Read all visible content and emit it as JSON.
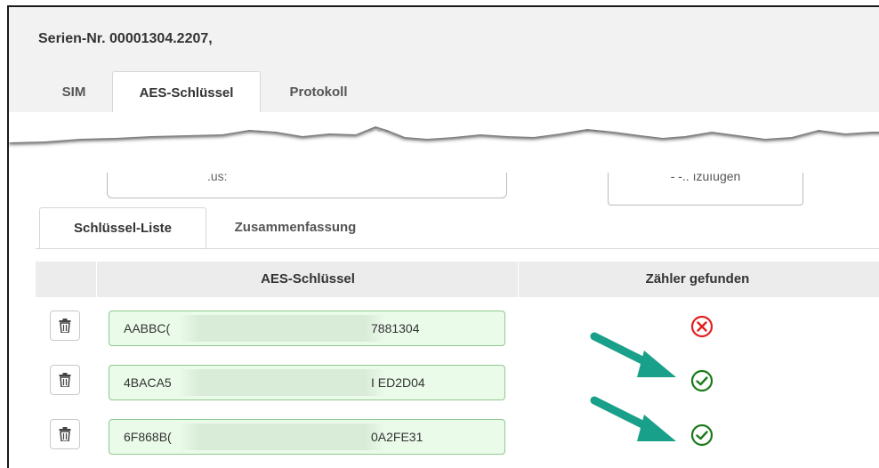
{
  "header": {
    "title": "Serien-Nr. 00001304.2207,"
  },
  "tabs": [
    {
      "label": "SIM",
      "active": false
    },
    {
      "label": "AES-Schlüssel",
      "active": true
    },
    {
      "label": "Protokoll",
      "active": false
    }
  ],
  "partial": {
    "input_fragment": ".us:",
    "button_fragment": "- -.. ızuıugen"
  },
  "subtabs": [
    {
      "label": "Schlüssel-Liste",
      "active": true
    },
    {
      "label": "Zusammenfassung",
      "active": false
    }
  ],
  "table": {
    "columns": [
      "AES-Schlüssel",
      "Zähler gefunden"
    ],
    "rows": [
      {
        "key_start": "AABBC(",
        "key_end": "7881304",
        "found": false
      },
      {
        "key_start": "4BACA5",
        "key_end": "I ED2D04",
        "found": true
      },
      {
        "key_start": "6F868B(",
        "key_end": "0A2FE31",
        "found": true
      }
    ]
  },
  "colors": {
    "success": "#1a7a1a",
    "error": "#e02020",
    "arrow": "#19a08a",
    "input_bg": "#eafbe9",
    "input_border": "#8fc98f"
  },
  "icons": {
    "trash": "trash-icon",
    "found": "check-circle-icon",
    "not_found": "x-circle-icon",
    "annotation": "arrow-icon"
  }
}
